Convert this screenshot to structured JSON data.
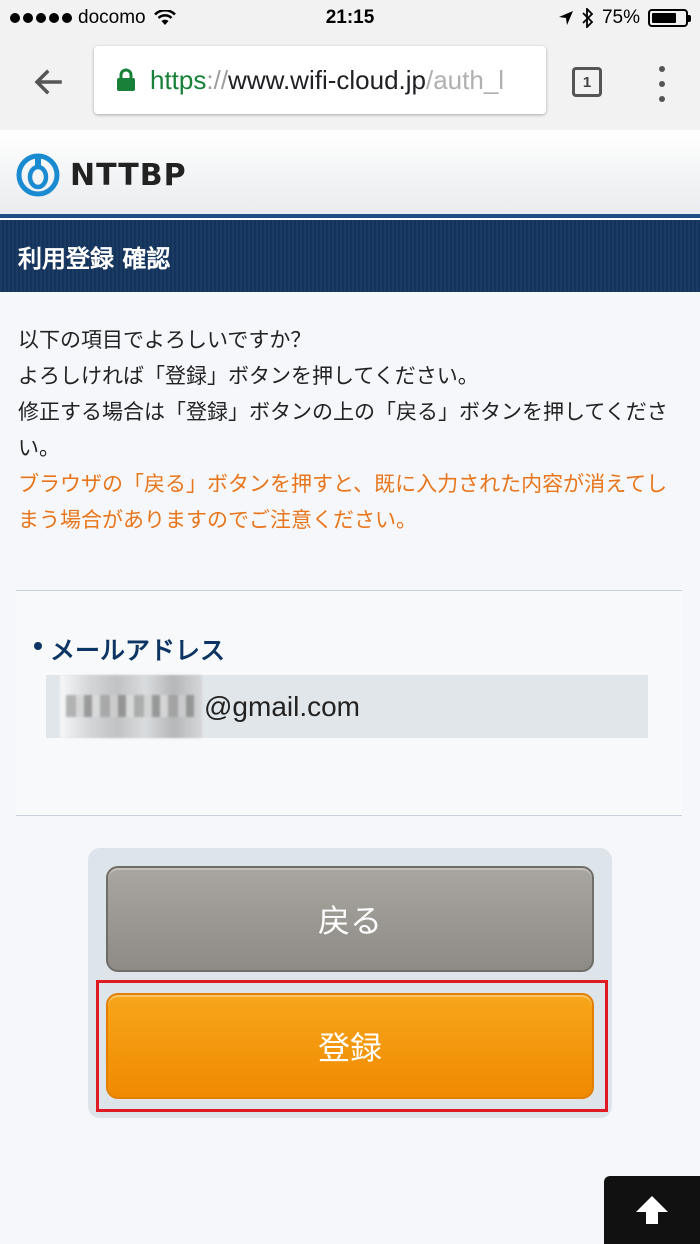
{
  "status_bar": {
    "carrier": "docomo",
    "time": "21:15",
    "battery_percent": "75%",
    "battery_level": 0.75
  },
  "browser": {
    "url_scheme": "https",
    "url_sep": "://",
    "url_host": "www.wifi-cloud.jp",
    "url_path": "/auth_l",
    "tab_count": "1"
  },
  "site": {
    "logo_text": "NTTBP",
    "page_title": "利用登録 確認"
  },
  "message": {
    "line1": "以下の項目でよろしいですか？",
    "line2": "よろしければ「登録」ボタンを押してください。",
    "line3": "修正する場合は「登録」ボタンの上の「戻る」ボタンを押してください。",
    "warning": "ブラウザの「戻る」ボタンを押すと、既に入力された内容が消えてしまう場合がありますのでご注意ください。"
  },
  "form": {
    "email_label": "メールアドレス",
    "email_domain": "@gmail.com"
  },
  "buttons": {
    "back_label": "戻る",
    "register_label": "登録"
  }
}
